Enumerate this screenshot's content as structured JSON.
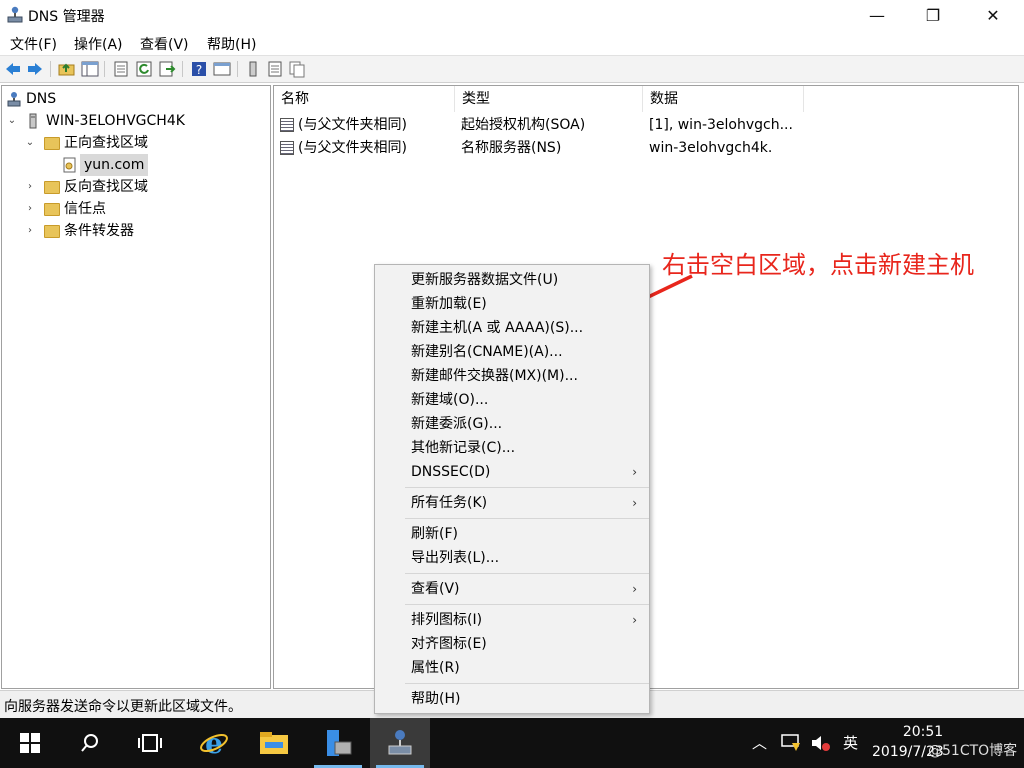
{
  "window": {
    "title": "DNS 管理器",
    "minimize_glyph": "—",
    "restore_glyph": "❐",
    "close_glyph": "✕"
  },
  "menu": [
    {
      "label": "文件(F)"
    },
    {
      "label": "操作(A)"
    },
    {
      "label": "查看(V)"
    },
    {
      "label": "帮助(H)"
    }
  ],
  "toolbar": {
    "icons": [
      "back-arrow-icon",
      "forward-arrow-icon",
      "up-folder-icon",
      "show-hide-tree-icon",
      "properties-icon",
      "refresh-icon",
      "export-list-icon",
      "help-icon",
      "console-icon",
      "server-icon",
      "record-list-icon",
      "copy-icon"
    ]
  },
  "tree": {
    "root": "DNS",
    "server": "WIN-3ELOHVGCH4K",
    "forward_zones": "正向查找区域",
    "zone": "yun.com",
    "reverse_zones": "反向查找区域",
    "trust_points": "信任点",
    "conditional_forwarders": "条件转发器"
  },
  "list": {
    "columns": [
      "名称",
      "类型",
      "数据"
    ],
    "rows": [
      {
        "name": "(与父文件夹相同)",
        "type": "起始授权机构(SOA)",
        "data": "[1], win-3elohvgch..."
      },
      {
        "name": "(与父文件夹相同)",
        "type": "名称服务器(NS)",
        "data": "win-3elohvgch4k."
      }
    ]
  },
  "context_menu": {
    "items": [
      {
        "label": "更新服务器数据文件(U)"
      },
      {
        "label": "重新加载(E)"
      },
      {
        "label": "新建主机(A 或 AAAA)(S)..."
      },
      {
        "label": "新建别名(CNAME)(A)..."
      },
      {
        "label": "新建邮件交换器(MX)(M)..."
      },
      {
        "label": "新建域(O)..."
      },
      {
        "label": "新建委派(G)..."
      },
      {
        "label": "其他新记录(C)..."
      },
      {
        "label": "DNSSEC(D)"
      },
      {
        "label": "所有任务(K)"
      },
      {
        "label": "刷新(F)"
      },
      {
        "label": "导出列表(L)..."
      },
      {
        "label": "查看(V)"
      },
      {
        "label": "排列图标(I)"
      },
      {
        "label": "对齐图标(E)"
      },
      {
        "label": "属性(R)"
      },
      {
        "label": "帮助(H)"
      }
    ],
    "submenu_glyph": "›"
  },
  "annotation": "右击空白区域，点击新建主机",
  "status_bar": "向服务器发送命令以更新此区域文件。",
  "taskbar": {
    "ime": "英",
    "time": "20:51",
    "date": "2019/7/23",
    "watermark": "@51CTO博客"
  },
  "colors": {
    "annotation": "#e8261c",
    "taskbar": "#101010",
    "selected_taskbar_item": "#3a3a3a"
  }
}
